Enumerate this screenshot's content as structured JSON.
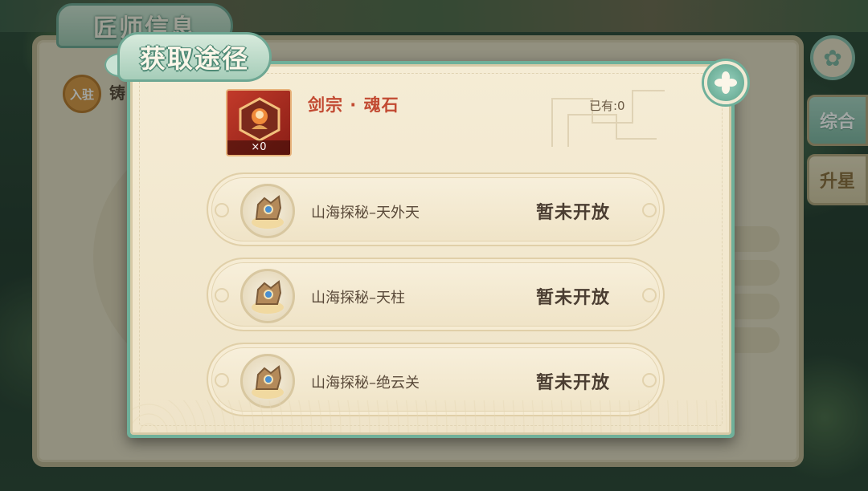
{
  "background": {
    "panel_title": "匠师信息",
    "badge": "入驻",
    "badge_text": "铸",
    "tabs": [
      "综合",
      "升星"
    ]
  },
  "modal": {
    "title": "获取途径",
    "item": {
      "name": "剑宗 · 魂石",
      "quantity": "×0",
      "owned": "已有:0"
    },
    "sources": [
      {
        "name": "山海探秘–天外天",
        "status": "暂未开放"
      },
      {
        "name": "山海探秘–天柱",
        "status": "暂未开放"
      },
      {
        "name": "山海探秘–绝云关",
        "status": "暂未开放"
      }
    ]
  },
  "colors": {
    "accent_teal": "#6fb09a",
    "parchment": "#f5ecd5",
    "item_name_red": "#c24a32"
  },
  "icons": {
    "close": "close-clover-icon",
    "source": "mountain-beast-medallion-icon",
    "item": "soul-stone-hexagon-icon"
  }
}
